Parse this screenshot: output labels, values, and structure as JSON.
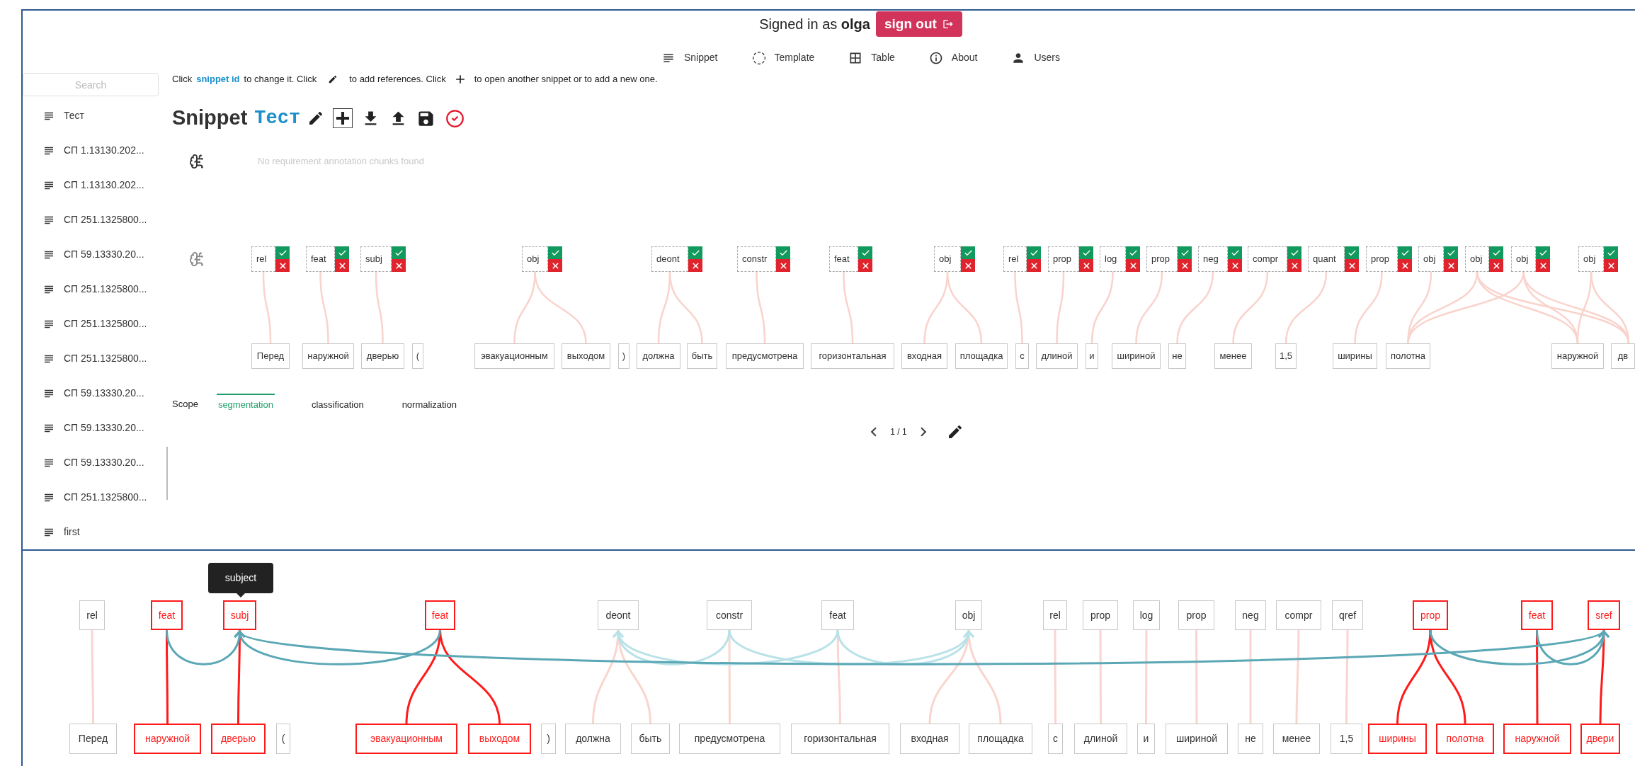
{
  "header": {
    "signed_in_prefix": "Signed in as",
    "user": "olga",
    "sign_out": "sign out"
  },
  "nav": [
    {
      "label": "Snippet"
    },
    {
      "label": "Template"
    },
    {
      "label": "Table"
    },
    {
      "label": "About"
    },
    {
      "label": "Users"
    }
  ],
  "sidebar": {
    "search_placeholder": "Search",
    "items": [
      {
        "label": "Тест"
      },
      {
        "label": "СП 1.13130.202..."
      },
      {
        "label": "СП 1.13130.202..."
      },
      {
        "label": "СП 251.1325800..."
      },
      {
        "label": "СП 59.13330.20..."
      },
      {
        "label": "СП 251.1325800..."
      },
      {
        "label": "СП 251.1325800..."
      },
      {
        "label": "СП 251.1325800..."
      },
      {
        "label": "СП 59.13330.20..."
      },
      {
        "label": "СП 59.13330.20..."
      },
      {
        "label": "СП 59.13330.20..."
      },
      {
        "label": "СП 251.1325800..."
      },
      {
        "label": "first"
      }
    ]
  },
  "hint": {
    "part_1": "Click",
    "link": "snippet id",
    "part_2": "to change it. Click",
    "part_3": "to add references. Click",
    "part_4": "to open another snippet or to add a new one."
  },
  "snippet": {
    "title": "Snippet",
    "id": "Тест"
  },
  "requirements": {
    "empty_message": "No requirement annotation chunks found"
  },
  "annotation": {
    "chunks": [
      {
        "label": "rel"
      },
      {
        "label": "feat"
      },
      {
        "label": "subj"
      },
      {
        "label": "obj"
      },
      {
        "label": "deont"
      },
      {
        "label": "constr"
      },
      {
        "label": "feat"
      },
      {
        "label": "obj"
      },
      {
        "label": "rel"
      },
      {
        "label": "prop"
      },
      {
        "label": "log"
      },
      {
        "label": "prop"
      },
      {
        "label": "neg"
      },
      {
        "label": "compr"
      },
      {
        "label": "quant"
      },
      {
        "label": "prop"
      },
      {
        "label": "obj"
      },
      {
        "label": "obj"
      },
      {
        "label": "obj"
      },
      {
        "label": "obj"
      }
    ],
    "tokens": [
      {
        "text": "Перед"
      },
      {
        "text": "наружной"
      },
      {
        "text": "дверью"
      },
      {
        "text": "("
      },
      {
        "text": "эвакуационным"
      },
      {
        "text": "выходом"
      },
      {
        "text": ")"
      },
      {
        "text": "должна"
      },
      {
        "text": "быть"
      },
      {
        "text": "предусмотрена"
      },
      {
        "text": "горизонтальная"
      },
      {
        "text": "входная"
      },
      {
        "text": "площадка"
      },
      {
        "text": "с"
      },
      {
        "text": "длиной"
      },
      {
        "text": "и"
      },
      {
        "text": "шириной"
      },
      {
        "text": "не"
      },
      {
        "text": "менее"
      },
      {
        "text": "1,5"
      },
      {
        "text": "ширины"
      },
      {
        "text": "полотна"
      },
      {
        "text": "наружной"
      },
      {
        "text": "дв"
      }
    ]
  },
  "scope": {
    "label": "Scope",
    "tabs": [
      {
        "label": "segmentation",
        "selected": true
      },
      {
        "label": "classification",
        "selected": false
      },
      {
        "label": "normalization",
        "selected": false
      }
    ]
  },
  "pagination": {
    "page": "1 / 1"
  },
  "graph": {
    "tooltip": "subject",
    "tags": [
      {
        "label": "rel",
        "highlighted": false
      },
      {
        "label": "feat",
        "highlighted": true
      },
      {
        "label": "subj",
        "highlighted": true
      },
      {
        "label": "feat",
        "highlighted": true
      },
      {
        "label": "deont",
        "highlighted": false
      },
      {
        "label": "constr",
        "highlighted": false
      },
      {
        "label": "feat",
        "highlighted": false
      },
      {
        "label": "obj",
        "highlighted": false
      },
      {
        "label": "rel",
        "highlighted": false
      },
      {
        "label": "prop",
        "highlighted": false
      },
      {
        "label": "log",
        "highlighted": false
      },
      {
        "label": "prop",
        "highlighted": false
      },
      {
        "label": "neg",
        "highlighted": false
      },
      {
        "label": "compr",
        "highlighted": false
      },
      {
        "label": "qref",
        "highlighted": false
      },
      {
        "label": "prop",
        "highlighted": true
      },
      {
        "label": "feat",
        "highlighted": true
      },
      {
        "label": "sref",
        "highlighted": true
      }
    ],
    "tokens": [
      {
        "text": "Перед",
        "highlighted": false
      },
      {
        "text": "наружной",
        "highlighted": true
      },
      {
        "text": "дверью",
        "highlighted": true
      },
      {
        "text": "(",
        "highlighted": false
      },
      {
        "text": "эвакуационным",
        "highlighted": true
      },
      {
        "text": "выходом",
        "highlighted": true
      },
      {
        "text": ")",
        "highlighted": false
      },
      {
        "text": "должна",
        "highlighted": false
      },
      {
        "text": "быть",
        "highlighted": false
      },
      {
        "text": "предусмотрена",
        "highlighted": false
      },
      {
        "text": "горизонтальная",
        "highlighted": false
      },
      {
        "text": "входная",
        "highlighted": false
      },
      {
        "text": "площадка",
        "highlighted": false
      },
      {
        "text": "с",
        "highlighted": false
      },
      {
        "text": "длиной",
        "highlighted": false
      },
      {
        "text": "и",
        "highlighted": false
      },
      {
        "text": "шириной",
        "highlighted": false
      },
      {
        "text": "не",
        "highlighted": false
      },
      {
        "text": "менее",
        "highlighted": false
      },
      {
        "text": "1,5",
        "highlighted": false
      },
      {
        "text": "ширины",
        "highlighted": true
      },
      {
        "text": "полотна",
        "highlighted": true
      },
      {
        "text": "наружной",
        "highlighted": true
      },
      {
        "text": "двери",
        "highlighted": true
      }
    ]
  }
}
